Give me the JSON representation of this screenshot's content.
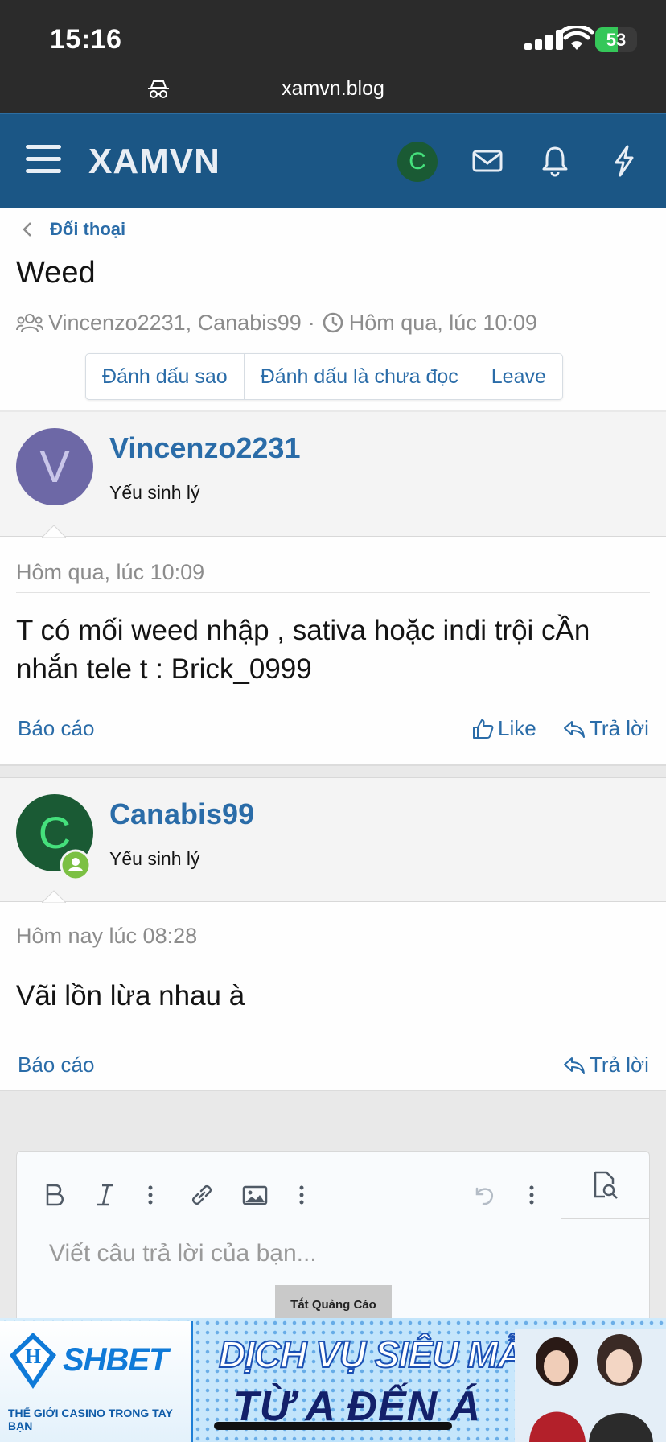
{
  "status_bar": {
    "time": "15:16",
    "battery": "53"
  },
  "browser": {
    "url": "xamvn.blog"
  },
  "header": {
    "logo": "XAMVN",
    "avatar_letter": "C"
  },
  "breadcrumb": {
    "label": "Đối thoại"
  },
  "conversation": {
    "title": "Weed",
    "participants": "Vincenzo2231, Canabis99",
    "separator": "·",
    "time": "Hôm qua, lúc 10:09",
    "buttons": {
      "star": "Đánh dấu sao",
      "unread": "Đánh dấu là chưa đọc",
      "leave": "Leave"
    }
  },
  "messages": [
    {
      "avatar_letter": "V",
      "username": "Vincenzo2231",
      "user_title": "Yếu sinh lý",
      "time": "Hôm qua, lúc 10:09",
      "text": "T có mối weed nhập , sativa hoặc indi trội cẦn nhắn tele t : Brick_0999",
      "report": "Báo cáo",
      "like": "Like",
      "reply": "Trả lời"
    },
    {
      "avatar_letter": "C",
      "username": "Canabis99",
      "user_title": "Yếu sinh lý",
      "time": "Hôm nay lúc 08:28",
      "text": "Vãi lồn lừa nhau à",
      "report": "Báo cáo",
      "reply": "Trả lời"
    }
  ],
  "editor": {
    "placeholder": "Viết câu trả lời của bạn..."
  },
  "ad": {
    "close_label": "Tắt Quảng Cáo",
    "brand": "SHBET",
    "tagline": "THẾ GIỚI CASINO TRONG TAY BẠN",
    "line1": "DỊCH VỤ SIÊU MẪU",
    "line2": "TỪ A ĐẾN Á"
  },
  "colors": {
    "header_bg": "#1b5685",
    "link": "#2a6ca8",
    "avatar_v": "#6d68a6",
    "avatar_c": "#1a5a34",
    "online": "#7bc043"
  }
}
